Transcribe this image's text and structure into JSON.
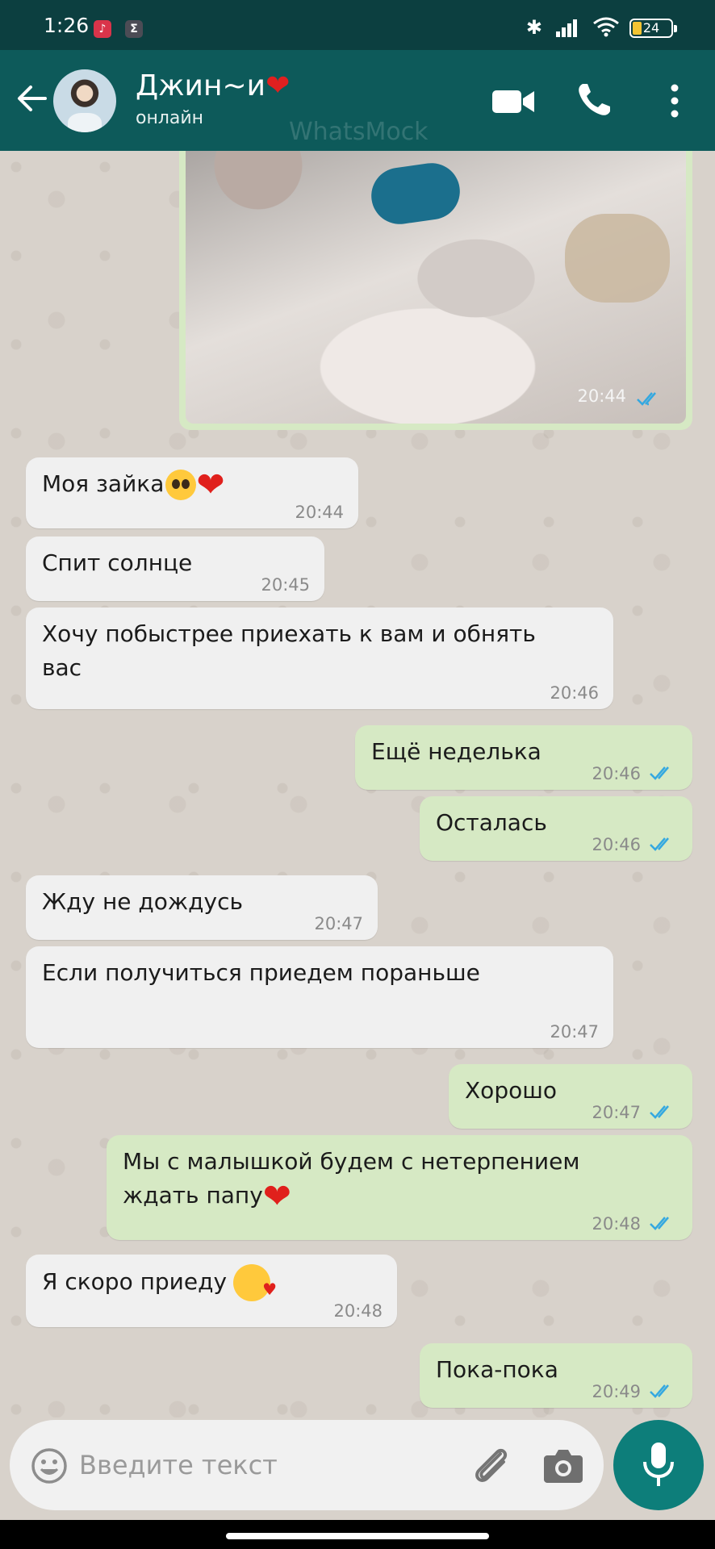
{
  "status_bar": {
    "time": "1:26",
    "battery": "24",
    "notif_icons": [
      "music-notification-icon",
      "sum-notification-icon"
    ],
    "right_icons": [
      "bluetooth-icon",
      "signal-icon",
      "wifi-icon",
      "battery-icon"
    ]
  },
  "header": {
    "contact_name": "Джин~и",
    "name_emoji": "❤",
    "status": "онлайн",
    "watermark": "WhatsMock",
    "icons": [
      "back-arrow-icon",
      "video-camera-icon",
      "phone-icon",
      "more-vert-icon"
    ]
  },
  "messages": {
    "photo": {
      "time": "20:44",
      "ticks": "read"
    },
    "m1": {
      "text": "Моя зайка",
      "time": "20:44"
    },
    "m2": {
      "text": "Спит солнце",
      "time": "20:45"
    },
    "m3": {
      "line1": "Хочу побыстрее приехать к вам и обнять",
      "line2": "вас",
      "time": "20:46"
    },
    "m4": {
      "text": "Ещё неделька",
      "time": "20:46"
    },
    "m5": {
      "text": "Осталась",
      "time": "20:46"
    },
    "m6": {
      "text": "Жду не дождусь",
      "time": "20:47"
    },
    "m7": {
      "text": "Если получиться приедем пораньше",
      "time": "20:47"
    },
    "m8": {
      "text": "Хорошо",
      "time": "20:47"
    },
    "m9": {
      "line1": "Мы с малышкой будем с нетерпением",
      "line2": "ждать папу",
      "time": "20:48"
    },
    "m10": {
      "text": "Я скоро приеду",
      "time": "20:48"
    },
    "m11": {
      "text": "Пока-пока",
      "time": "20:49"
    }
  },
  "composer": {
    "placeholder": "Введите текст",
    "icons": [
      "emoji-icon",
      "paperclip-icon",
      "camera-icon",
      "microphone-icon"
    ]
  },
  "colors": {
    "header": "#0d5a5a",
    "status_bar": "#0c3f40",
    "outgoing_bubble": "#d6e9c4",
    "incoming_bubble": "#f0f0f0",
    "read_ticks": "#34a8e0",
    "mic_button": "#0d7e7a"
  }
}
